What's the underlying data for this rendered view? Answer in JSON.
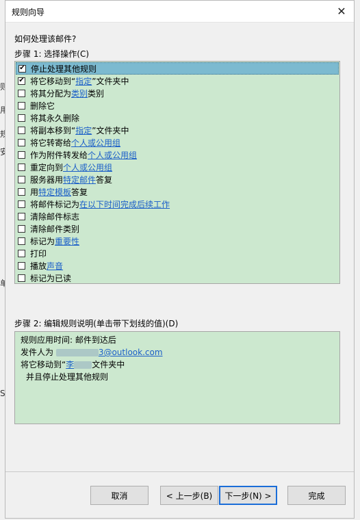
{
  "dialog": {
    "title": "规则向导",
    "close_glyph": "✕"
  },
  "question": "如何处理该邮件?",
  "step1_label": "步骤 1: 选择操作(C)",
  "actions": [
    {
      "parts": [
        {
          "t": "停止处理其他规则"
        }
      ],
      "checked": true,
      "selected": true
    },
    {
      "parts": [
        {
          "t": "将它移动到“"
        },
        {
          "t": "指定",
          "link": true
        },
        {
          "t": "”文件夹中"
        }
      ],
      "checked": true
    },
    {
      "parts": [
        {
          "t": "将其分配为 "
        },
        {
          "t": "类别",
          "link": true
        },
        {
          "t": " 类别"
        }
      ],
      "checked": false
    },
    {
      "parts": [
        {
          "t": "删除它"
        }
      ],
      "checked": false
    },
    {
      "parts": [
        {
          "t": "将其永久删除"
        }
      ],
      "checked": false
    },
    {
      "parts": [
        {
          "t": "将副本移到“"
        },
        {
          "t": "指定",
          "link": true
        },
        {
          "t": "”文件夹中"
        }
      ],
      "checked": false
    },
    {
      "parts": [
        {
          "t": "将它转寄给 "
        },
        {
          "t": "个人或公用组",
          "link": true
        }
      ],
      "checked": false
    },
    {
      "parts": [
        {
          "t": "作为附件转发给 "
        },
        {
          "t": "个人或公用组",
          "link": true
        }
      ],
      "checked": false
    },
    {
      "parts": [
        {
          "t": "重定向到 "
        },
        {
          "t": "个人或公用组",
          "link": true
        }
      ],
      "checked": false
    },
    {
      "parts": [
        {
          "t": "服务器用 "
        },
        {
          "t": "特定邮件",
          "link": true
        },
        {
          "t": " 答复"
        }
      ],
      "checked": false
    },
    {
      "parts": [
        {
          "t": "用 "
        },
        {
          "t": "特定模板",
          "link": true
        },
        {
          "t": " 答复"
        }
      ],
      "checked": false
    },
    {
      "parts": [
        {
          "t": "将邮件标记为 "
        },
        {
          "t": "在以下时间完成后续工作",
          "link": true
        }
      ],
      "checked": false
    },
    {
      "parts": [
        {
          "t": "清除邮件标志"
        }
      ],
      "checked": false
    },
    {
      "parts": [
        {
          "t": "清除邮件类别"
        }
      ],
      "checked": false
    },
    {
      "parts": [
        {
          "t": "标记为 "
        },
        {
          "t": "重要性",
          "link": true
        }
      ],
      "checked": false
    },
    {
      "parts": [
        {
          "t": "打印"
        }
      ],
      "checked": false
    },
    {
      "parts": [
        {
          "t": "播放 "
        },
        {
          "t": "声音",
          "link": true
        }
      ],
      "checked": false
    },
    {
      "parts": [
        {
          "t": "标记为已读"
        }
      ],
      "checked": false
    }
  ],
  "step2_label": "步骤 2: 编辑规则说明(单击带下划线的值)(D)",
  "description": {
    "line1": "规则应用时间: 邮件到达后",
    "line2_prefix": "发件人为 ",
    "line2_link": "3@outlook.com",
    "line3_prefix": "将它移动到“",
    "line3_link": "李",
    "line3_suffix": "文件夹中",
    "line4": "并且停止处理其他规则"
  },
  "buttons": {
    "cancel": "取消",
    "back": "< 上一步(B)",
    "next": "下一步(N) >",
    "finish": "完成"
  },
  "edge": {
    "a": "则",
    "b": "用",
    "c": "规",
    "d": "安",
    "e": "单",
    "f": "S"
  }
}
